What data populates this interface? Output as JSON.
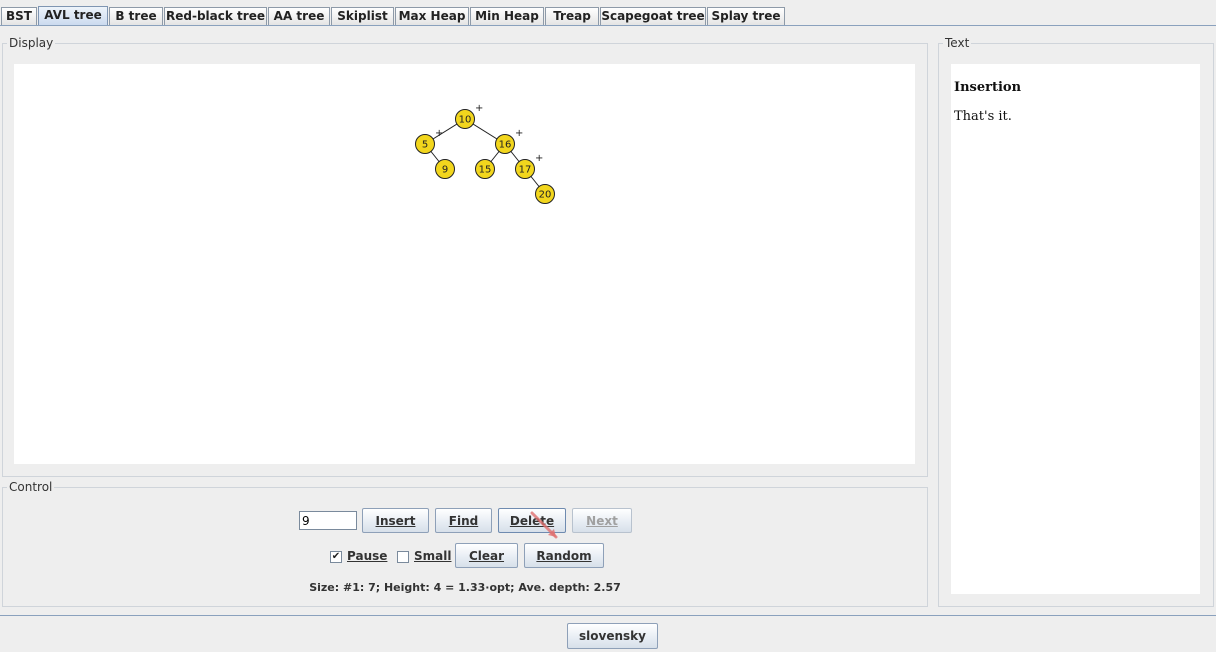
{
  "tabs": [
    {
      "label": "BST",
      "active": false
    },
    {
      "label": "AVL tree",
      "active": true
    },
    {
      "label": "B tree",
      "active": false
    },
    {
      "label": "Red-black tree",
      "active": false
    },
    {
      "label": "AA tree",
      "active": false
    },
    {
      "label": "Skiplist",
      "active": false
    },
    {
      "label": "Max Heap",
      "active": false
    },
    {
      "label": "Min Heap",
      "active": false
    },
    {
      "label": "Treap",
      "active": false
    },
    {
      "label": "Scapegoat tree",
      "active": false
    },
    {
      "label": "Splay tree",
      "active": false
    }
  ],
  "display": {
    "legend": "Display",
    "tree": {
      "nodes": [
        {
          "key": "10",
          "balance": "+"
        },
        {
          "key": "5",
          "balance": "+"
        },
        {
          "key": "16",
          "balance": "+"
        },
        {
          "key": "9",
          "balance": ""
        },
        {
          "key": "15",
          "balance": ""
        },
        {
          "key": "17",
          "balance": "+"
        },
        {
          "key": "20",
          "balance": ""
        }
      ],
      "colors": {
        "node_fill": "#f2d61d",
        "node_stroke": "#222222",
        "edge": "#222222"
      }
    }
  },
  "text_panel": {
    "legend": "Text",
    "heading": "Insertion",
    "body": "That's it."
  },
  "control": {
    "legend": "Control",
    "input_value": "9",
    "insert_label": "Insert",
    "find_label": "Find",
    "delete_label": "Delete",
    "next_label": "Next",
    "pause_label": "Pause",
    "pause_checked": true,
    "small_label": "Small",
    "small_checked": false,
    "clear_label": "Clear",
    "random_label": "Random",
    "status": "Size: #1: 7;   Height: 4 =  1.33·opt;   Ave. depth: 2.57"
  },
  "footer": {
    "language_label": "slovensky"
  }
}
